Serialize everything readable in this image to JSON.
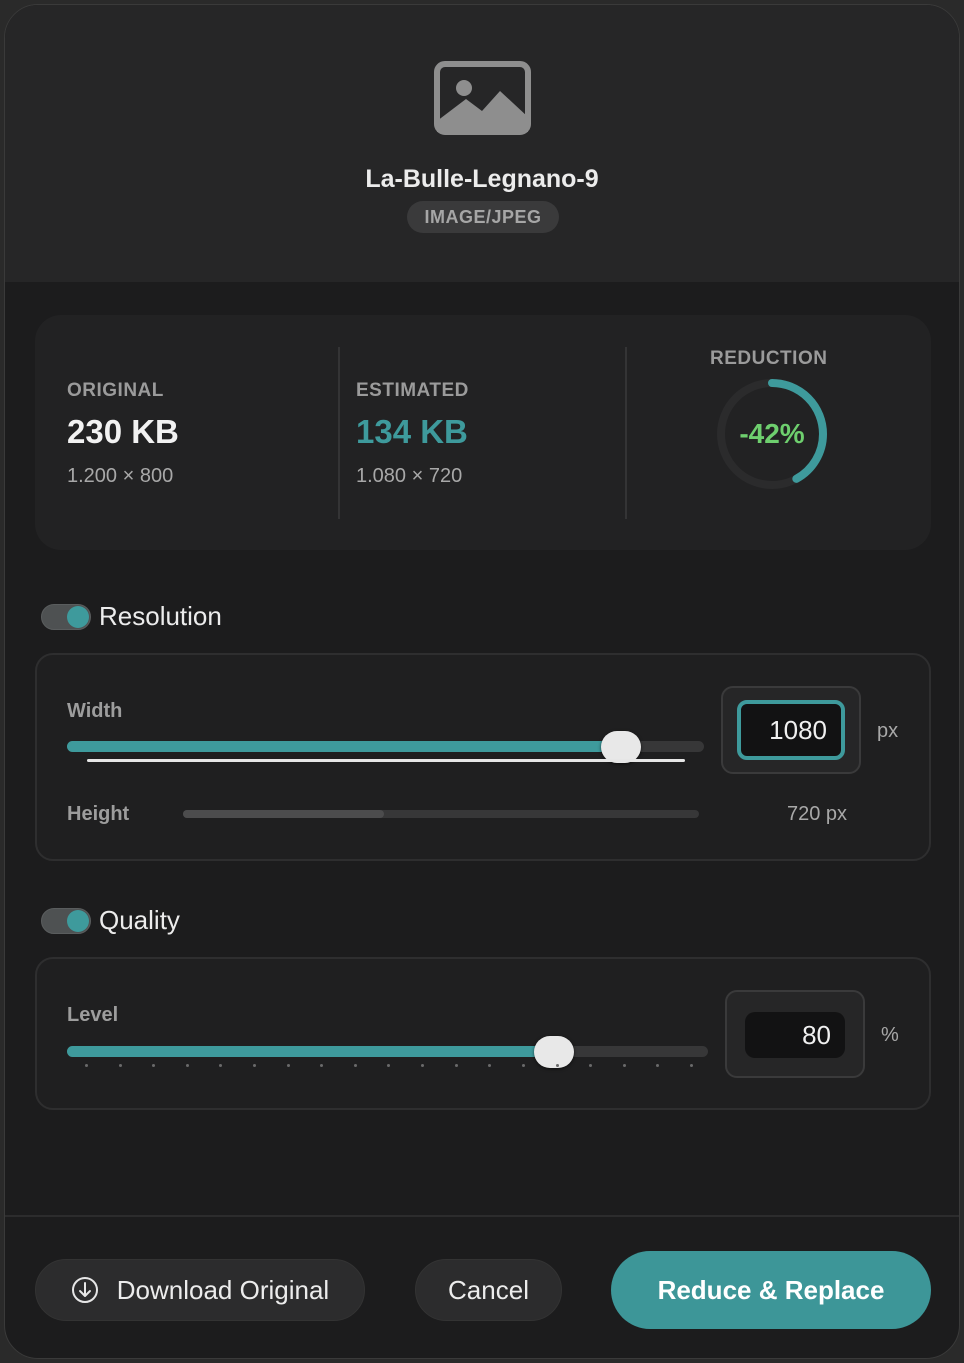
{
  "file": {
    "name": "La-Bulle-Legnano-9",
    "mime": "IMAGE/JPEG",
    "icon": "image-icon"
  },
  "stats": {
    "original": {
      "label": "ORIGINAL",
      "size": "230 KB",
      "dims": "1.200 × 800"
    },
    "estimated": {
      "label": "ESTIMATED",
      "size": "134 KB",
      "dims": "1.080 × 720"
    },
    "reduction": {
      "label": "REDUCTION",
      "value": "-42%",
      "fraction": 0.42
    }
  },
  "resolution": {
    "title": "Resolution",
    "enabled": true,
    "width_label": "Width",
    "width_value": "1080",
    "width_unit": "px",
    "width_fraction": 0.87,
    "height_label": "Height",
    "height_value": "720 px",
    "height_fraction": 0.39
  },
  "quality": {
    "title": "Quality",
    "enabled": true,
    "level_label": "Level",
    "level_value": "80",
    "level_unit": "%",
    "level_fraction": 0.76
  },
  "buttons": {
    "download": "Download Original",
    "cancel": "Cancel",
    "confirm": "Reduce & Replace"
  },
  "colors": {
    "accent": "#3e9a9c",
    "reduction_text": "#6ecf6e",
    "background": "#1c1c1d"
  }
}
